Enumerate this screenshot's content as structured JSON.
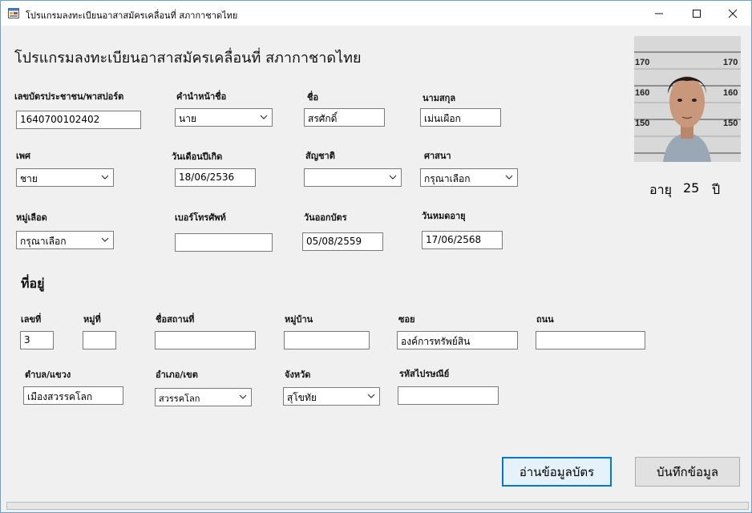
{
  "window": {
    "title": "โปรแกรมลงทะเบียนอาสาสมัครเคลื่อนที่ สภากาชาดไทย",
    "minimize": "—",
    "maximize": "☐",
    "close": "✕"
  },
  "heading": "โปรแกรมลงทะเบียนอาสาสมัครเคลื่อนที่ สภากาชาดไทย",
  "labels": {
    "id_card": "เลขบัตรประชาชน/พาสปอร์ต",
    "prefix": "คำนำหน้าชื่อ",
    "first_name": "ชื่อ",
    "last_name": "นามสกุล",
    "gender": "เพศ",
    "birth_date": "วันเดือนปีเกิด",
    "nationality": "สัญชาติ",
    "religion": "ศาสนา",
    "blood_group": "หมู่เลือด",
    "phone": "เบอร์โทรศัพท์",
    "issue_date": "วันออกบัตร",
    "expiry_date": "วันหมดอายุ",
    "address_section": "ที่อยู่",
    "house_no": "เลขที่",
    "moo": "หมู่ที่",
    "place_name": "ชื่อสถานที่",
    "village": "หมู่บ้าน",
    "soi": "ซอย",
    "road": "ถนน",
    "subdistrict": "ตำบล/แขวง",
    "district": "อำเภอ/เขต",
    "province": "จังหวัด",
    "postal_code": "รหัสไปรษณีย์"
  },
  "values": {
    "id_card": "1640700102402",
    "prefix": "นาย",
    "first_name": "สรศักดิ์",
    "last_name": "เม่นเผือก",
    "gender": "ชาย",
    "birth_date": "18/06/2536",
    "nationality": "",
    "religion": "กรุณาเลือก",
    "blood_group": "กรุณาเลือก",
    "phone": "",
    "issue_date": "05/08/2559",
    "expiry_date": "17/06/2568",
    "house_no": "3",
    "moo": "",
    "place_name": "",
    "village": "",
    "soi": "องค์การทรัพย์สิน",
    "road": "",
    "subdistrict": "เมืองสวรรคโลก",
    "district": "สวรรคโลก",
    "province": "สุโขทัย",
    "postal_code": ""
  },
  "age": {
    "prefix": "อายุ",
    "value": "25",
    "suffix": "ปี"
  },
  "buttons": {
    "read_card": "อ่านข้อมูลบัตร",
    "save": "บันทึกข้อมูล"
  },
  "icons": {
    "app": "app-form-icon",
    "dropdown": "chevron-down-icon"
  },
  "progress": 0
}
